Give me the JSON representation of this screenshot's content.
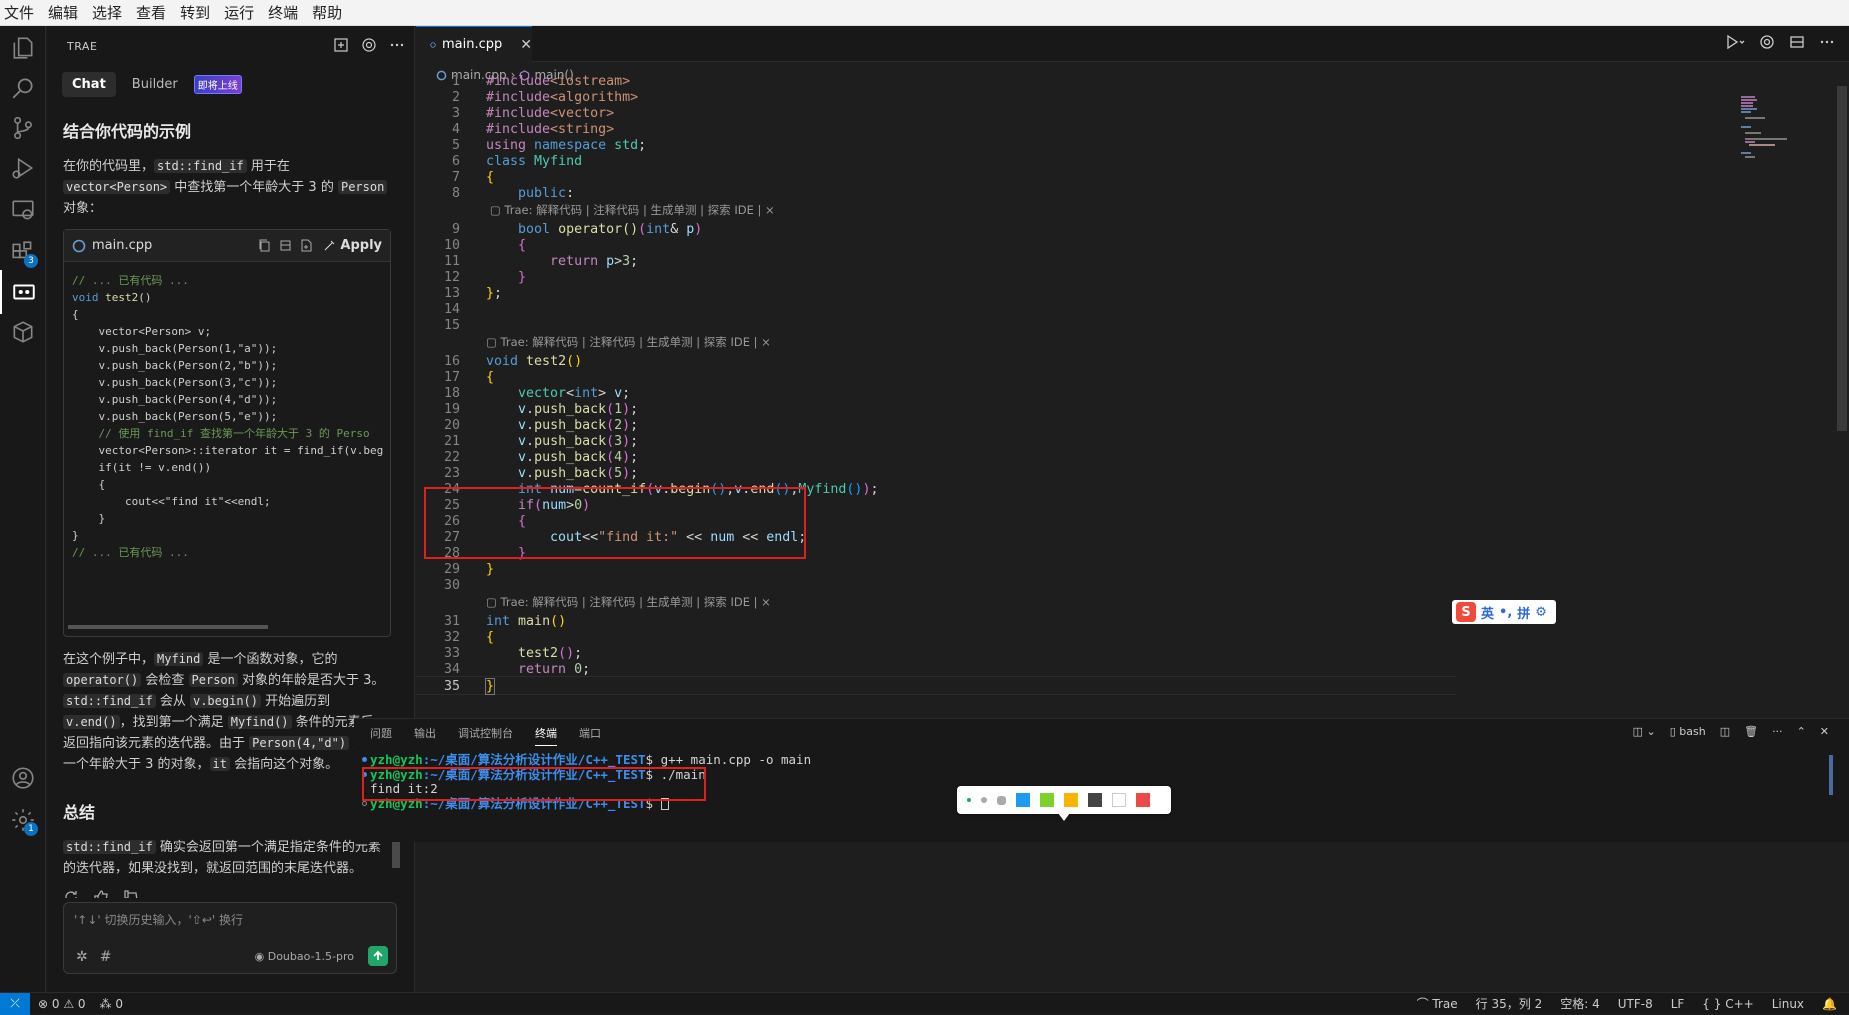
{
  "menu": [
    "文件",
    "编辑",
    "选择",
    "查看",
    "转到",
    "运行",
    "终端",
    "帮助"
  ],
  "activity": {
    "extensions_badge": "3",
    "settings_badge": "1"
  },
  "sidebar": {
    "title": "TRAE",
    "tab_chat": "Chat",
    "tab_builder": "Builder",
    "builder_tag": "即将上线",
    "heading1": "结合你代码的示例",
    "intro": {
      "t1": "在你的代码里，",
      "c1": "std::find_if",
      "t2": " 用于在 ",
      "c2": "vector<Person>",
      "t3": " 中查找第一个年龄大于 3 的 ",
      "c3": "Person",
      "t4": " 对象："
    },
    "codecard": {
      "filename": "main.cpp",
      "apply_label": "Apply",
      "lines": [
        "// ... 已有代码 ...",
        "void test2()",
        "{",
        "    vector<Person> v;",
        "    v.push_back(Person(1,\"a\"));",
        "    v.push_back(Person(2,\"b\"));",
        "    v.push_back(Person(3,\"c\"));",
        "    v.push_back(Person(4,\"d\"));",
        "    v.push_back(Person(5,\"e\"));",
        "    // 使用 find_if 查找第一个年龄大于 3 的 Perso",
        "    vector<Person>::iterator it = find_if(v.beg",
        "    if(it != v.end())",
        "    {",
        "        cout<<\"find it\"<<endl;",
        "    }",
        "}",
        "// ... 已有代码 ..."
      ]
    },
    "explain": {
      "t1": "在这个例子中，",
      "c1": "Myfind",
      "t2": " 是一个函数对象，它的 ",
      "c2": "operator()",
      "t3": " 会检查 ",
      "c3": "Person",
      "t4": " 对象的年龄是否大于 3。",
      "c4": "std::find_if",
      "t5": " 会从 ",
      "c5": "v.begin()",
      "t6": " 开始遍历到 ",
      "c6": "v.end()",
      "t7": "，找到第一个满足 ",
      "c7": "Myfind()",
      "t8": " 条件的元素后，返回指向该元素的迭代器。由于 ",
      "c8": "Person(4,\"d\")",
      "t9": " 是第一个年龄大于 3 的对象，",
      "c9": "it",
      "t10": " 会指向这个对象。"
    },
    "heading2": "总结",
    "summary": {
      "c1": "std::find_if",
      "t1": " 确实会返回第一个满足指定条件的元素的迭代器，如果没找到，就返回范围的末尾迭代器。"
    },
    "input_placeholder": "'↑↓' 切换历史输入，'⇧↩' 换行",
    "model": "Doubao-1.5-pro"
  },
  "editor": {
    "tab_label": "main.cpp",
    "breadcrumb_file": "main.cpp",
    "breadcrumb_symbol": "main()",
    "codelens": "Trae: 解释代码 | 注释代码 | 生成单测 | 探索 IDE | ×",
    "line_numbers": [
      "1",
      "2",
      "3",
      "4",
      "5",
      "6",
      "7",
      "8",
      "9",
      "10",
      "11",
      "12",
      "13",
      "14",
      "15",
      "16",
      "17",
      "18",
      "19",
      "20",
      "21",
      "22",
      "23",
      "24",
      "25",
      "26",
      "27",
      "28",
      "29",
      "30",
      "31",
      "32",
      "33",
      "34",
      "35"
    ],
    "lines": [
      "#include<iostream>",
      "#include<algorithm>",
      "#include<vector>",
      "#include<string>",
      "using namespace std;",
      "class Myfind",
      "{",
      "    public:",
      "    bool operator()(int& p)",
      "    {",
      "        return p>3;",
      "    }",
      "};",
      "",
      "",
      "void test2()",
      "{",
      "    vector<int> v;",
      "    v.push_back(1);",
      "    v.push_back(2);",
      "    v.push_back(3);",
      "    v.push_back(4);",
      "    v.push_back(5);",
      "    int num=count_if(v.begin(),v.end(),Myfind());",
      "    if(num>0)",
      "    {",
      "        cout<<\"find it:\" << num << endl;",
      "    }",
      "}",
      "",
      "int main()",
      "{",
      "    test2();",
      "    return 0;",
      "}"
    ],
    "ime": {
      "english": "英",
      "mode": "拼"
    }
  },
  "panel": {
    "tabs": [
      "问题",
      "输出",
      "调试控制台",
      "终端",
      "端口"
    ],
    "active_tab": "终端",
    "shell": "bash",
    "terminal": [
      {
        "user": "yzh@yzh",
        "path": ":~/桌面/算法分析设计作业/C++_TEST",
        "cmd": "$ g++ main.cpp -o main"
      },
      {
        "user": "yzh@yzh",
        "path": ":~/桌面/算法分析设计作业/C++_TEST",
        "cmd": "$ ./main"
      },
      {
        "output": "find it:2"
      },
      {
        "user": "yzh@yzh",
        "path": ":~/桌面/算法分析设计作业/C++_TEST",
        "cmd": "$ "
      }
    ],
    "palette_colors": [
      "#1e9bf0",
      "#7cd12b",
      "#f7b500",
      "#444444",
      "#ffffff",
      "#f04848"
    ]
  },
  "status": {
    "errors": "0",
    "warnings": "0",
    "ports": "0",
    "trae": "Trae",
    "position": "行 35，列 2",
    "spaces": "空格: 4",
    "encoding": "UTF-8",
    "eol": "LF",
    "language": "C++",
    "os": "Linux"
  }
}
